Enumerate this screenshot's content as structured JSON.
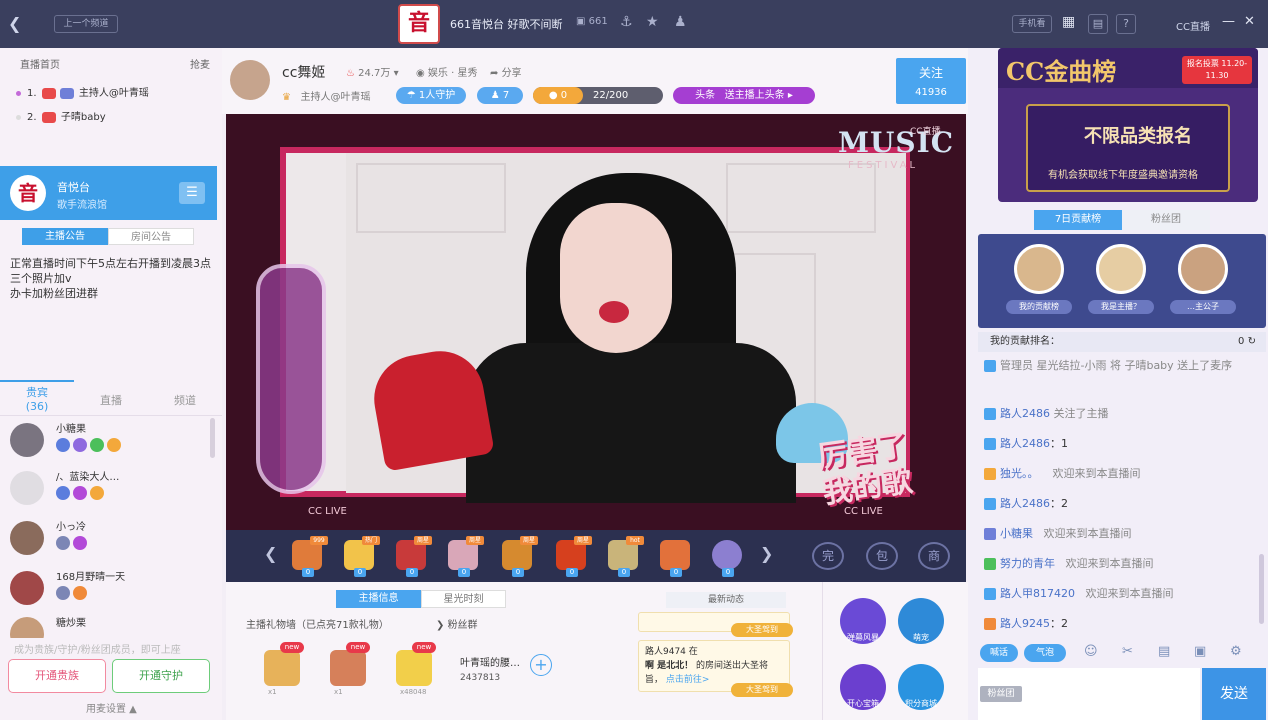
{
  "topbar": {
    "prev_label": "上一个频道",
    "logo_char": "音",
    "room_title": "661音悦台 好歌不间断",
    "room_count": "661",
    "phone_label": "手机看",
    "cc_label": "CC直播"
  },
  "left": {
    "rank_header": "直播首页",
    "rank_more": "抢麦",
    "rank_rows": [
      {
        "num": "1.",
        "text": "主持人@叶青瑶"
      },
      {
        "num": "2.",
        "text": "子晴baby"
      }
    ],
    "anchor": {
      "name": "音悦台",
      "sub": "歌手流浪馆",
      "logo": "音"
    },
    "notice_tabs": [
      "主播公告",
      "房间公告"
    ],
    "notice_text": "正常直播时间下午5点左右开播到凌晨3点\n三个照片加v\n办卡加粉丝团进群",
    "audience_tabs": [
      {
        "label": "贵宾",
        "count": "(36)"
      },
      {
        "label": "直播"
      },
      {
        "label": "频道"
      }
    ],
    "audience": [
      {
        "name": "小糖果"
      },
      {
        "name": "/、蓝染大人…"
      },
      {
        "name": "小っ冷"
      },
      {
        "name": "168月野晴一天"
      },
      {
        "name": "糖炒栗"
      }
    ],
    "open_tip": "成为贵族/守护/粉丝团成员，即可上座",
    "open_noble": "开通贵族",
    "open_guard": "开通守护",
    "bottom_setting": "用麦设置"
  },
  "center": {
    "anchor_name": "cc舞姬",
    "heat": "24.7万",
    "category": "娱乐 · 星秀",
    "share": "分享",
    "host_line": "主持人@叶青瑶",
    "guard_label": "1人守护",
    "fans_label": "7",
    "progress_zero": "0",
    "progress_value": "22/200",
    "headline_label": "头条",
    "headline_text": "送主播上头条",
    "follow_label": "关注",
    "follow_count": "41936"
  },
  "video": {
    "music_text": "MUSIC",
    "festival_text": "FESTIVAL",
    "cclive": "CC LIVE",
    "big_text_1": "厉害了",
    "big_text_2": "我的歌",
    "corner_tag": "CC直播"
  },
  "gifts": [
    {
      "color": "#e07b3a",
      "tag": "999"
    },
    {
      "color": "#f2c34a",
      "tag": "热门"
    },
    {
      "color": "#c83a3a",
      "tag": "周星"
    },
    {
      "color": "#d9a7b8",
      "tag": "周星"
    },
    {
      "color": "#d68a2f",
      "tag": "周星"
    },
    {
      "color": "#d6401e",
      "tag": "周星"
    },
    {
      "color": "#c9b47a",
      "tag": "hot"
    },
    {
      "color": "#e2713b",
      "tag": ""
    },
    {
      "color": "#8c7fd0",
      "tag": ""
    }
  ],
  "gift_tools": [
    "完",
    "包",
    "商"
  ],
  "below": {
    "tabs": [
      "主播信息",
      "星光时刻"
    ],
    "wall_title": "主播礼物墙（已点亮71款礼物）",
    "fans_group": "粉丝群",
    "wall_gifts": [
      {
        "color": "#e7b25a",
        "new": "new",
        "count": "x1"
      },
      {
        "color": "#d6805a",
        "new": "new",
        "count": "x1"
      },
      {
        "color": "#f2cf4a",
        "new": "new",
        "count": "x48048"
      }
    ],
    "wall_name": "叶青瑶的腰…",
    "wall_number": "2437813",
    "news_header": "最新动态",
    "news": [
      {
        "text": "路人9474 在",
        "bold": "啊 是北北！",
        "rest": "的房间送出大圣将旨，",
        "link": "点击前往>",
        "badge": "大圣驾到"
      }
    ],
    "news_badge_top": "大圣驾到",
    "actions": [
      {
        "label": "弹幕风暴",
        "color": "#6a4ad6"
      },
      {
        "label": "萌宠",
        "color": "#2e8ad8"
      },
      {
        "label": "开心宝箱",
        "color": "#6b3fcf"
      },
      {
        "label": "积分商城",
        "color": "#2a93e0"
      }
    ]
  },
  "right": {
    "banner_title": "CC金曲榜",
    "banner_tag": "报名投票 11.20-11.30",
    "banner_main": "不限品类报名",
    "banner_sub": "有机会获取线下年度盛典邀请资格",
    "rank_tabs": [
      "7日贡献榜",
      "粉丝团"
    ],
    "rank_labels": [
      "我的贡献榜",
      "我是主播？",
      "…主公子"
    ],
    "my_rank_label": "我的贡献排名：",
    "my_rank_value": "0",
    "chat": [
      {
        "type": "sys",
        "text": "管理员 星光结拉-小雨 将 子晴baby 送上了麦序"
      },
      {
        "type": "sys",
        "nick": "路人2486",
        "text": "关注了主播"
      },
      {
        "type": "msg",
        "nick": "路人2486",
        "text": "：1"
      },
      {
        "type": "msg",
        "nick": "独光。。",
        "text": "欢迎来到本直播间"
      },
      {
        "type": "msg",
        "nick": "路人2486",
        "text": "：2"
      },
      {
        "type": "msg",
        "nick": "小糖果",
        "text": "欢迎来到本直播间"
      },
      {
        "type": "msg",
        "nick": "努力的青年",
        "text": "欢迎来到本直播间"
      },
      {
        "type": "msg",
        "nick": "路人甲817420",
        "text": "欢迎来到本直播间"
      },
      {
        "type": "msg",
        "nick": "路人9245",
        "text": "：2"
      }
    ],
    "toolbar_speak": "喊话",
    "toolbar_bubble": "气泡",
    "fansclub": "粉丝团",
    "send_label": "发送"
  }
}
